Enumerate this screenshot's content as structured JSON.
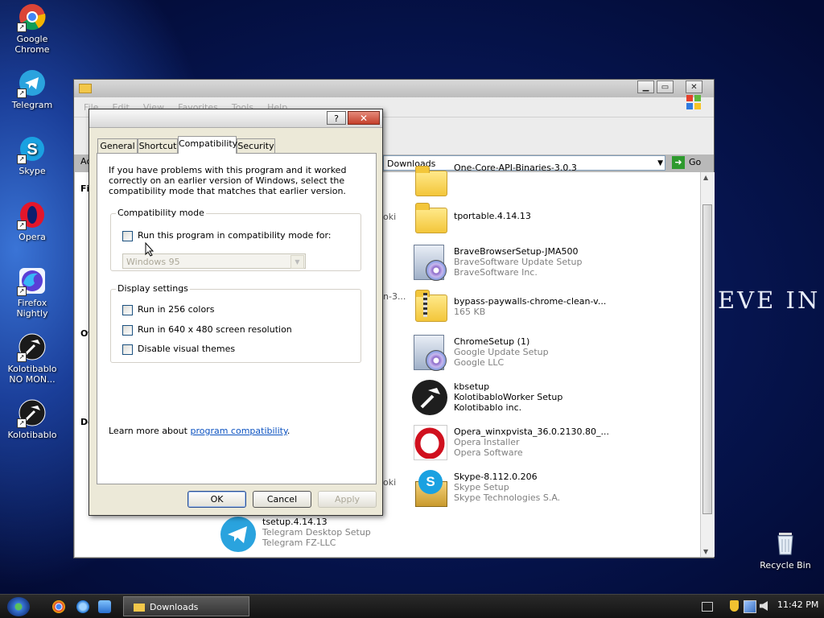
{
  "desktop": {
    "icons": [
      {
        "label": "Google Chrome",
        "icon": "chrome-icon"
      },
      {
        "label": "Telegram",
        "icon": "telegram-icon"
      },
      {
        "label": "Skype",
        "icon": "skype-icon"
      },
      {
        "label": "Opera",
        "icon": "opera-icon"
      },
      {
        "label": "Firefox Nightly",
        "icon": "firefox-nightly-icon"
      },
      {
        "label": "Kolotibablo NO MON...",
        "icon": "hammer-icon"
      },
      {
        "label": "Kolotibablo",
        "icon": "hammer-icon"
      }
    ],
    "recycle_bin": "Recycle Bin",
    "wallpaper_text": "EVE IN"
  },
  "explorer": {
    "menu": [
      "File",
      "Edit",
      "View",
      "Favorites",
      "Tools",
      "Help"
    ],
    "address": "Downloads",
    "go_label": "Go",
    "left_fragments": [
      "Ac",
      "Fil",
      "Ot",
      "De"
    ],
    "row_fragments": [
      "oki",
      "n-3...",
      "oki",
      "oki"
    ],
    "files": [
      {
        "name": "One-Core-API-Binaries-3.0.3",
        "line2": "",
        "line3": "",
        "icon": "folder-icon"
      },
      {
        "name": "tportable.4.14.13",
        "line2": "",
        "line3": "",
        "icon": "folder-icon"
      },
      {
        "name": "BraveBrowserSetup-JMA500",
        "line2": "BraveSoftware Update Setup",
        "line3": "BraveSoftware Inc.",
        "icon": "installer-icon"
      },
      {
        "name": "bypass-paywalls-chrome-clean-v...",
        "line2": "165 KB",
        "line3": "",
        "icon": "zip-folder-icon"
      },
      {
        "name": "ChromeSetup (1)",
        "line2": "Google Update Setup",
        "line3": "Google LLC",
        "icon": "installer-icon"
      },
      {
        "name": "kbsetup",
        "line2": "KolotibabloWorker Setup",
        "line3": "Kolotibablo inc.",
        "icon": "hammer-icon"
      },
      {
        "name": "Opera_winxpvista_36.0.2130.80_...",
        "line2": "Opera Installer",
        "line3": "Opera Software",
        "icon": "opera-icon"
      },
      {
        "name": "Skype-8.112.0.206",
        "line2": "Skype Setup",
        "line3": "Skype Technologies S.A.",
        "icon": "skype-installer-icon"
      },
      {
        "name": "tsetup.4.14.13",
        "line2": "Telegram Desktop Setup",
        "line3": "Telegram FZ-LLC",
        "icon": "telegram-icon"
      }
    ]
  },
  "dialog": {
    "tabs": [
      "General",
      "Shortcut",
      "Compatibility",
      "Security"
    ],
    "active_tab": "Compatibility",
    "intro": "If you have problems with this program and it worked correctly on an earlier version of Windows, select the compatibility mode that matches that earlier version.",
    "compat_group": "Compatibility mode",
    "compat_checkbox": "Run this program in compatibility mode for:",
    "compat_select_value": "Windows 95",
    "display_group": "Display settings",
    "display_options": [
      "Run in 256 colors",
      "Run in 640 x 480 screen resolution",
      "Disable visual themes"
    ],
    "learn_prefix": "Learn more about",
    "learn_link": "program compatibility",
    "learn_suffix": ".",
    "help_label": "?",
    "buttons": {
      "ok": "OK",
      "cancel": "Cancel",
      "apply": "Apply"
    }
  },
  "taskbar": {
    "active_window": "Downloads",
    "clock": "11:42 PM"
  }
}
